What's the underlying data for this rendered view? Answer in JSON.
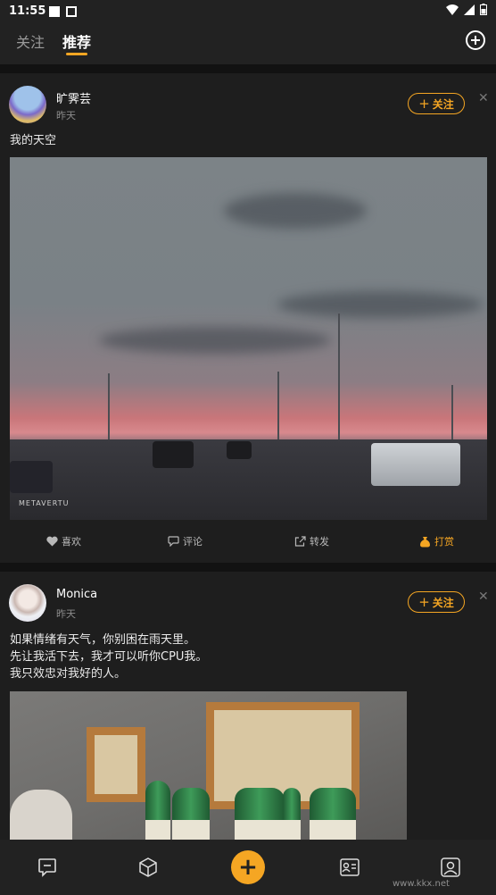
{
  "status_bar": {
    "time": "11:55"
  },
  "tabs": {
    "follow": "关注",
    "recommend": "推荐"
  },
  "posts": [
    {
      "username": "旷霁芸",
      "time": "昨天",
      "follow_label": "关注",
      "text": "我的天空",
      "photo_watermark": "METAVERTU",
      "actions": {
        "like": "喜欢",
        "comment": "评论",
        "share": "转发",
        "reward": "打赏"
      }
    },
    {
      "username": "Monica",
      "time": "昨天",
      "follow_label": "关注",
      "text": "如果情绪有天气，你别困在雨天里。\n先让我活下去，我才可以听你CPU我。\n我只效忠对我好的人。"
    }
  ],
  "watermark": {
    "site": "www.kkx.net"
  },
  "colors": {
    "accent": "#f5a623",
    "background": "#121212",
    "card": "#1e1e1e"
  }
}
